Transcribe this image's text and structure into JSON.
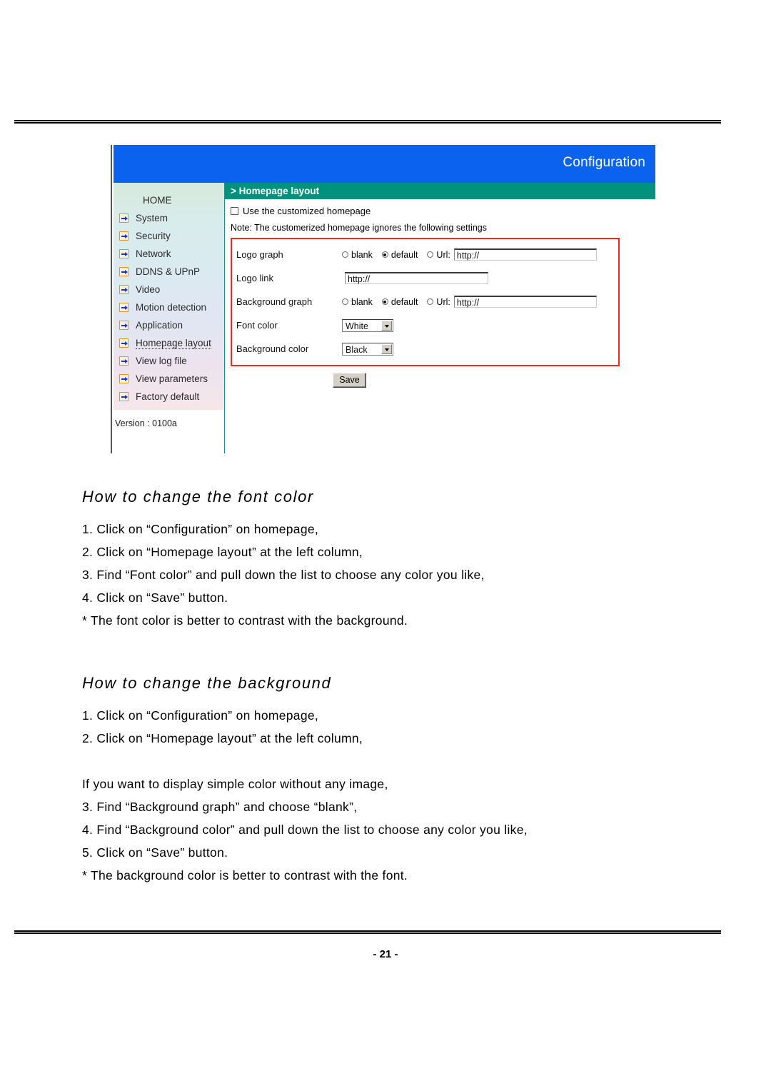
{
  "document": {
    "page_number": "- 21 -"
  },
  "device_ui": {
    "header": {
      "title": "Configuration"
    },
    "section_bar": {
      "label": "> Homepage layout"
    },
    "sidebar": {
      "items": [
        {
          "label": "HOME",
          "icon": null,
          "current": false
        },
        {
          "label": "System",
          "icon": "arrow-bullet-icon",
          "current": false
        },
        {
          "label": "Security",
          "icon": "arrow-bullet-icon",
          "current": false
        },
        {
          "label": "Network",
          "icon": "arrow-bullet-icon",
          "current": false
        },
        {
          "label": "DDNS & UPnP",
          "icon": "arrow-bullet-icon",
          "current": false
        },
        {
          "label": "Video",
          "icon": "arrow-bullet-icon",
          "current": false
        },
        {
          "label": "Motion detection",
          "icon": "arrow-bullet-icon",
          "current": false
        },
        {
          "label": "Application",
          "icon": "arrow-bullet-icon",
          "current": false
        },
        {
          "label": "Homepage layout",
          "icon": "arrow-bullet-icon",
          "current": true
        },
        {
          "label": "View log file",
          "icon": "arrow-bullet-icon",
          "current": false
        },
        {
          "label": "View parameters",
          "icon": "arrow-bullet-icon",
          "current": false
        },
        {
          "label": "Factory default",
          "icon": "arrow-bullet-icon",
          "current": false
        }
      ],
      "version": "Version : 0100a"
    },
    "form": {
      "customized_homepage": {
        "label": "Use the customized homepage",
        "checked": false
      },
      "note": "Note: The customerized homepage ignores the following settings",
      "logo_graph": {
        "label": "Logo graph",
        "options": [
          "blank",
          "default",
          "Url:"
        ],
        "selected": "default",
        "url_value": "http://"
      },
      "logo_link": {
        "label": "Logo link",
        "value": "http://"
      },
      "background_graph": {
        "label": "Background graph",
        "options": [
          "blank",
          "default",
          "Url:"
        ],
        "selected": "default",
        "url_value": "http://"
      },
      "font_color": {
        "label": "Font color",
        "value": "White"
      },
      "background_color": {
        "label": "Background color",
        "value": "Black"
      },
      "save_label": "Save"
    },
    "colors": {
      "header_blue": "#0a62ef",
      "section_green": "#00927c",
      "annotation_red": "#ee2a22"
    }
  },
  "sections": [
    {
      "title": "How to change the font color",
      "lines": [
        "1. Click on “Configuration” on homepage,",
        "2. Click on “Homepage layout” at the left column,",
        "3. Find “Font color” and pull down the list to choose any color you like,",
        "4. Click on “Save” button.",
        "*  The font color is better to contrast with the background."
      ]
    },
    {
      "title": "How to change the background",
      "lines": [
        "1. Click on “Configuration” on homepage,",
        "2. Click on “Homepage layout” at the left column,",
        "",
        "If you want to display simple color without any image,",
        "3. Find “Background graph” and choose “blank”,",
        "4. Find “Background color” and pull down the list to choose any color you like,",
        "5. Click on “Save” button.",
        "*  The background color is better to contrast with the font."
      ]
    }
  ]
}
